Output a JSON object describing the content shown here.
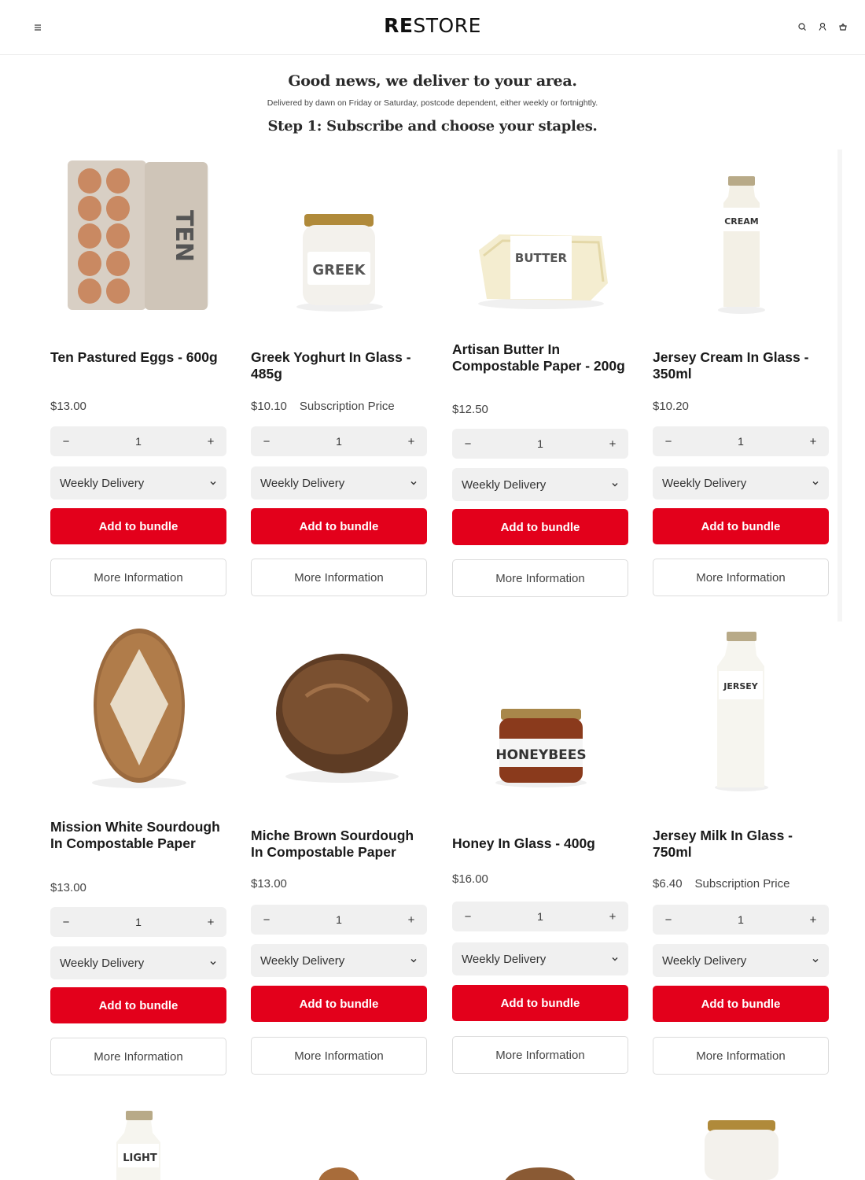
{
  "header": {
    "logo_bold": "RE",
    "logo_rest": "STORE",
    "icons": [
      "menu-icon",
      "search-icon",
      "account-icon",
      "basket-icon"
    ]
  },
  "intro": {
    "title": "Good news, we deliver to your area.",
    "subtitle": "Delivered by dawn on Friday or Saturday, postcode dependent, either weekly or fortnightly.",
    "step": "Step 1: Subscribe and choose your staples."
  },
  "colors": {
    "accent": "#e3001b",
    "control_bg": "#f0f0f0"
  },
  "products": [
    {
      "name": "Ten Pastured Eggs - 600g",
      "price": "$13.00",
      "subscription_label": "",
      "quantity": "1",
      "delivery": "Weekly Delivery",
      "add_label": "Add to bundle",
      "more_label": "More Information",
      "image": "egg-carton",
      "image_label": "TEN"
    },
    {
      "name": "Greek Yoghurt In Glass - 485g",
      "price": "$10.10",
      "subscription_label": "Subscription Price",
      "quantity": "1",
      "delivery": "Weekly Delivery",
      "add_label": "Add to bundle",
      "more_label": "More Information",
      "image": "yoghurt-jar",
      "image_label": "GREEK"
    },
    {
      "name": "Artisan Butter In Compostable Paper - 200g",
      "price": "$12.50",
      "subscription_label": "",
      "quantity": "1",
      "delivery": "Weekly Delivery",
      "add_label": "Add to bundle",
      "more_label": "More Information",
      "image": "butter-block",
      "image_label": "BUTTER"
    },
    {
      "name": "Jersey Cream In Glass - 350ml",
      "price": "$10.20",
      "subscription_label": "",
      "quantity": "1",
      "delivery": "Weekly Delivery",
      "add_label": "Add to bundle",
      "more_label": "More Information",
      "image": "cream-bottle",
      "image_label": "CREAM"
    },
    {
      "name": "Mission White Sourdough In Compostable Paper",
      "price": "$13.00",
      "subscription_label": "",
      "quantity": "1",
      "delivery": "Weekly Delivery",
      "add_label": "Add to bundle",
      "more_label": "More Information",
      "image": "white-sourdough",
      "image_label": ""
    },
    {
      "name": "Miche Brown Sourdough In Compostable Paper",
      "price": "$13.00",
      "subscription_label": "",
      "quantity": "1",
      "delivery": "Weekly Delivery",
      "add_label": "Add to bundle",
      "more_label": "More Information",
      "image": "brown-sourdough",
      "image_label": ""
    },
    {
      "name": "Honey In Glass - 400g",
      "price": "$16.00",
      "subscription_label": "",
      "quantity": "1",
      "delivery": "Weekly Delivery",
      "add_label": "Add to bundle",
      "more_label": "More Information",
      "image": "honey-jar",
      "image_label": "HONEYBEES"
    },
    {
      "name": "Jersey Milk In Glass - 750ml",
      "price": "$6.40",
      "subscription_label": "Subscription Price",
      "quantity": "1",
      "delivery": "Weekly Delivery",
      "add_label": "Add to bundle",
      "more_label": "More Information",
      "image": "milk-bottle",
      "image_label": "JERSEY"
    }
  ],
  "partial_products": [
    {
      "image": "light-milk-bottle",
      "image_label": "LIGHT"
    },
    {
      "image": "bread-top",
      "image_label": ""
    },
    {
      "image": "bread-top",
      "image_label": ""
    },
    {
      "image": "jar-top",
      "image_label": ""
    }
  ]
}
